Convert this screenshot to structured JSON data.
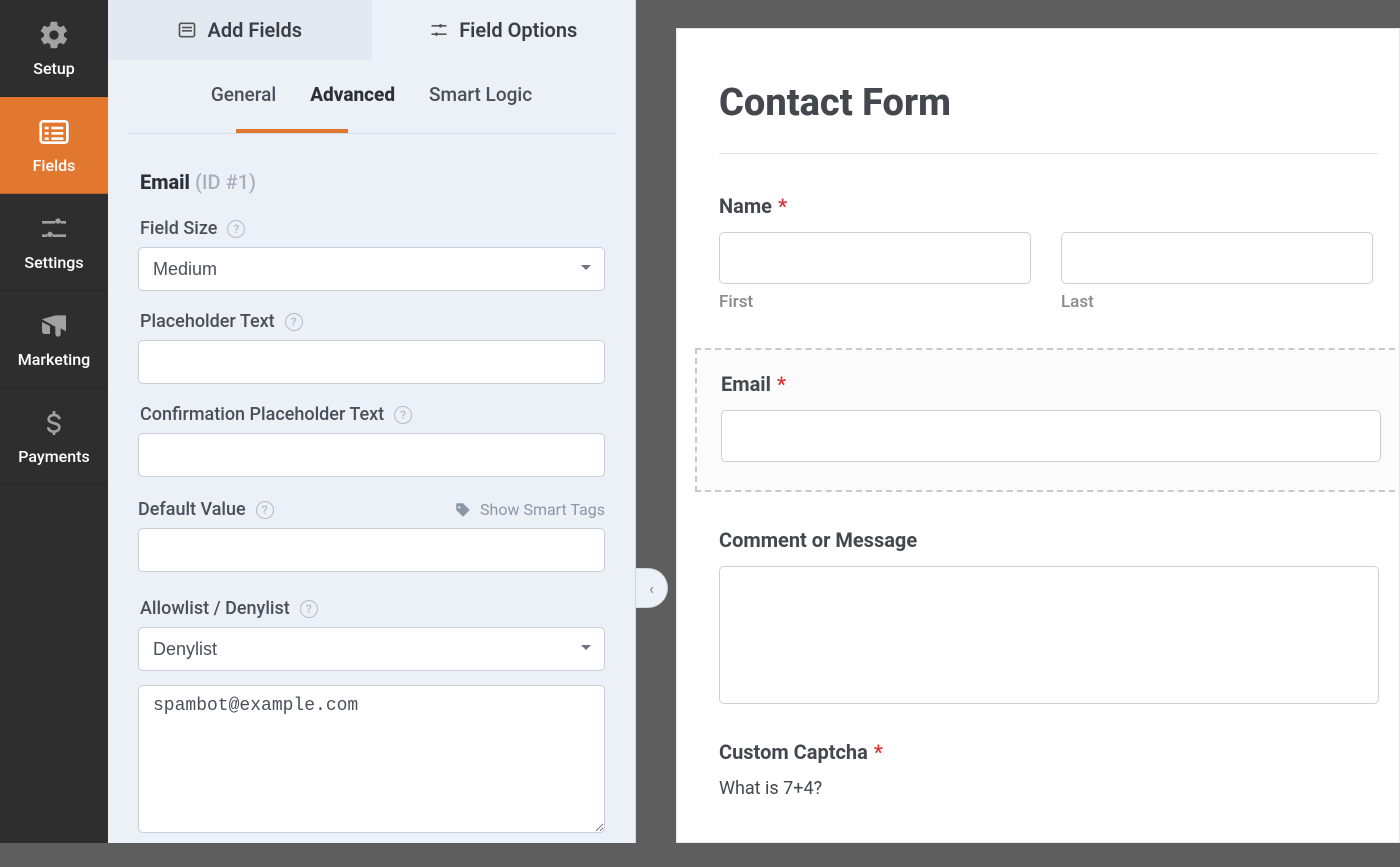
{
  "rail": {
    "setup": "Setup",
    "fields": "Fields",
    "settings": "Settings",
    "marketing": "Marketing",
    "payments": "Payments"
  },
  "panel_tabs": {
    "add": "Add Fields",
    "options": "Field Options"
  },
  "subtabs": {
    "general": "General",
    "advanced": "Advanced",
    "smart": "Smart Logic"
  },
  "field": {
    "name": "Email",
    "id_label": "(ID #1)",
    "size_label": "Field Size",
    "size_value": "Medium",
    "placeholder_label": "Placeholder Text",
    "confirm_placeholder_label": "Confirmation Placeholder Text",
    "default_label": "Default Value",
    "smart_tags": "Show Smart Tags",
    "allow_label": "Allowlist / Denylist",
    "allow_mode": "Denylist",
    "allow_text": "spambot@example.com"
  },
  "preview": {
    "title": "Contact Form",
    "name_label": "Name",
    "first": "First",
    "last": "Last",
    "email_label": "Email",
    "comment_label": "Comment or Message",
    "captcha_label": "Custom Captcha",
    "captcha_q": "What is 7+4?"
  }
}
